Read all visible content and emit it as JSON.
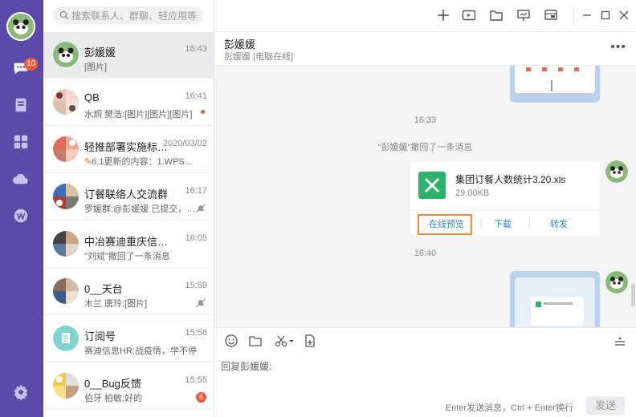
{
  "search": {
    "placeholder": "搜索联系人、群聊、轻应用等"
  },
  "rail": {
    "chat_badge": "10"
  },
  "conversations": [
    {
      "name": "彭媛媛",
      "time": "16:43",
      "preview": "[图片]"
    },
    {
      "name": "QB",
      "time": "16:41",
      "preview": "水炯 樊浩:[图片][图片][图片]"
    },
    {
      "name": "轻推部署实施标准...",
      "time": "2020/03/02",
      "preview": "6.1更新的内容：1.WPS..."
    },
    {
      "name": "订餐联络人交流群",
      "time": "16:17",
      "preview": "罗媛群:@彭媛媛 已提交，有..."
    },
    {
      "name": "中冶赛迪重庆信息...",
      "time": "16:05",
      "preview": "\"刘斌\"撤回了一条消息"
    },
    {
      "name": "0__天台",
      "time": "15:59",
      "preview": "木兰 唐玲:[图片]"
    },
    {
      "name": "订阅号",
      "time": "15:58",
      "preview": "赛迪信息HR:战疫情，学不停"
    },
    {
      "name": "0__Bug反馈",
      "time": "15:55",
      "preview": "伯牙 柏敏:好的",
      "unread": "6"
    }
  ],
  "chat": {
    "title": "彭媛媛",
    "subtitle": "彭媛媛 [电脑在线]",
    "time1": "16:33",
    "recall": "\"彭媛媛\"撤回了一条消息",
    "file": {
      "name": "集团订餐人数统计3.20.xls",
      "size": "29.00KB"
    },
    "actions": {
      "preview": "在线预览",
      "download": "下载",
      "forward": "转发"
    },
    "time2": "16:40"
  },
  "input": {
    "reply_label": "回复彭媛媛:",
    "hint": "Enter发送消息，Ctrl + Enter换行",
    "send": "发送"
  },
  "colors": {
    "rail": "#5b4aa8",
    "accent": "#2f7fd8",
    "highlight": "#f08a3a",
    "file_green": "#2fb36a"
  }
}
